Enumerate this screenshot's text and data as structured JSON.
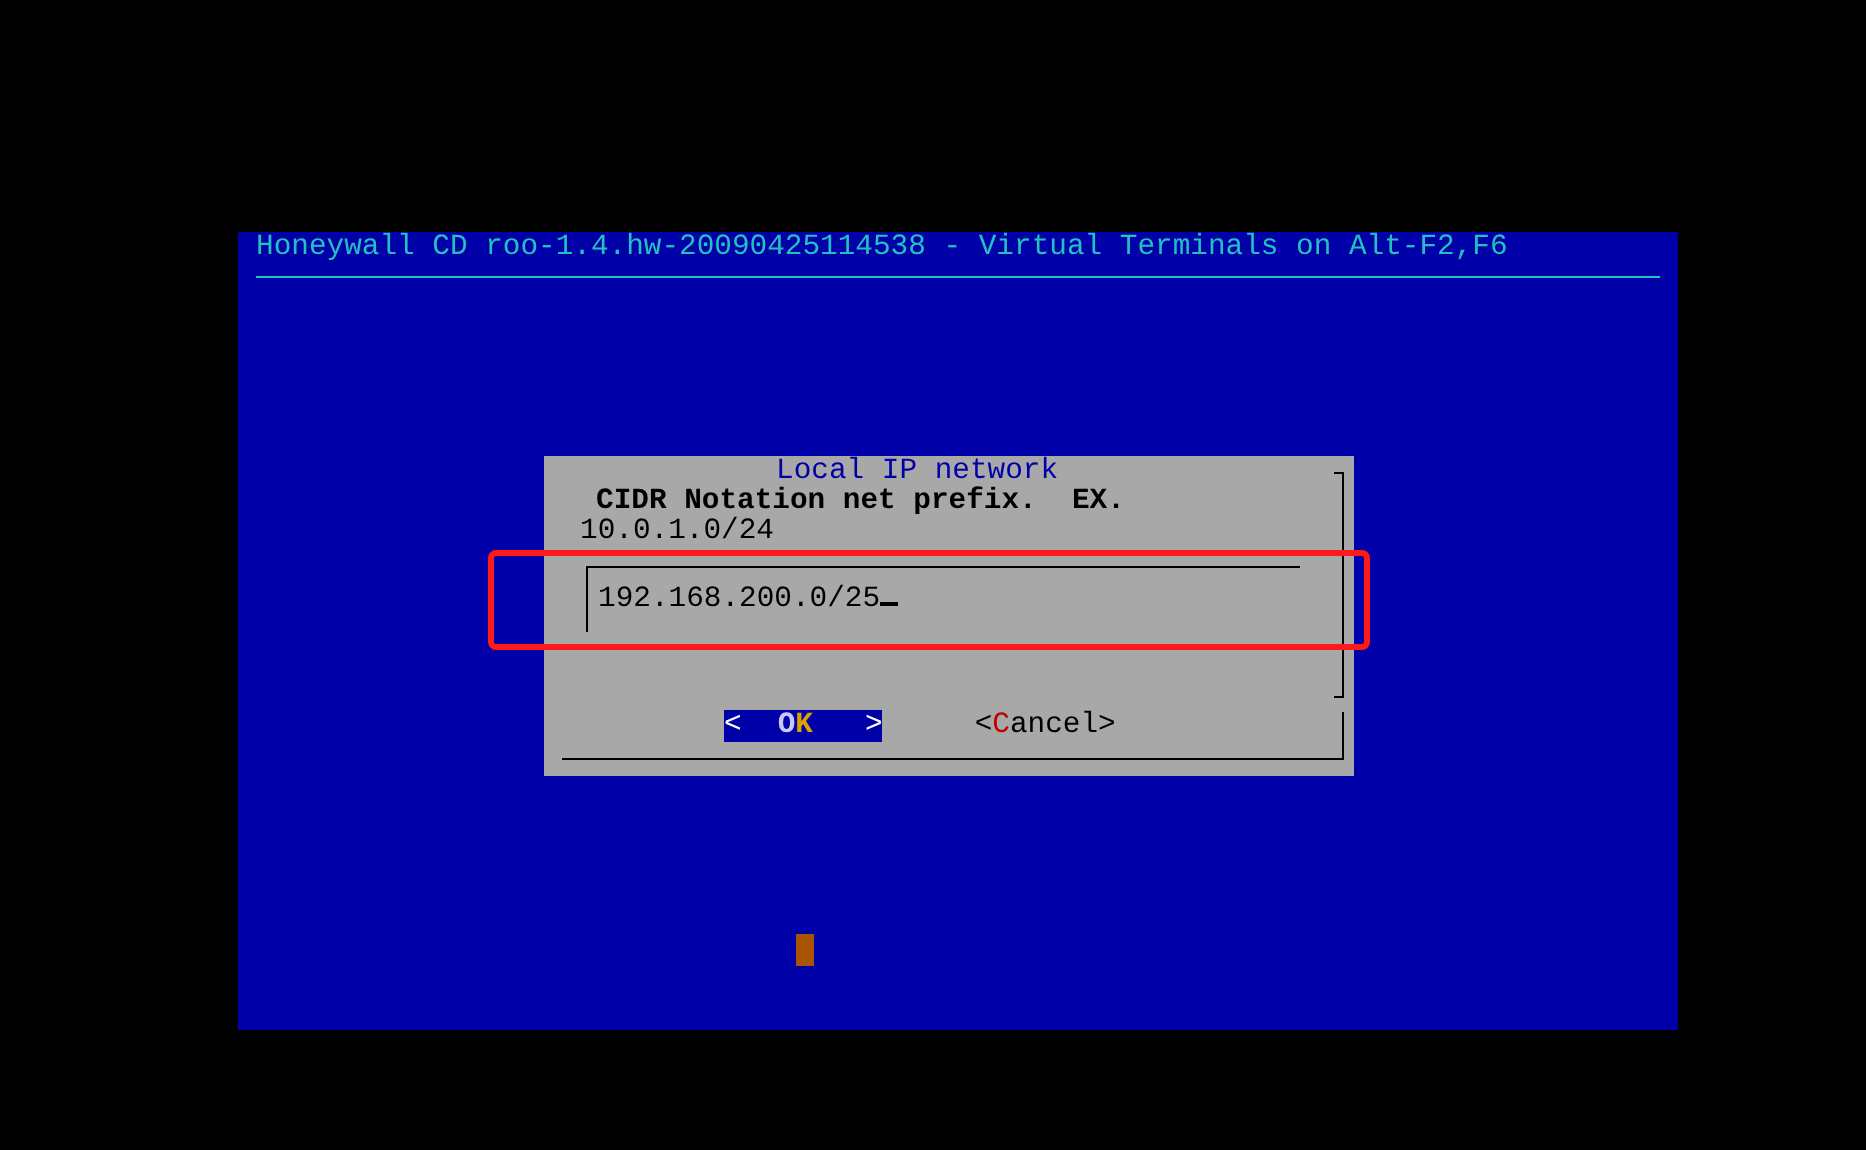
{
  "header": {
    "title": "Honeywall CD roo-1.4.hw-20090425114538 - Virtual Terminals on Alt-F2,F6"
  },
  "dialog": {
    "title": "Local IP network",
    "prompt": "CIDR Notation net prefix.  EX.",
    "example": "10.0.1.0/24",
    "input": {
      "value": "192.168.200.0/25"
    },
    "buttons": [
      {
        "selected": true,
        "parts": [
          {
            "text": "<"
          },
          {
            "text": "O"
          },
          {
            "text": "K",
            "hotkey": true
          },
          {
            "text": ">"
          }
        ]
      },
      {
        "selected": false,
        "parts": [
          {
            "text": "<"
          },
          {
            "text": "C",
            "hotkey": true
          },
          {
            "text": "ancel"
          },
          {
            "text": ">"
          }
        ]
      }
    ]
  }
}
